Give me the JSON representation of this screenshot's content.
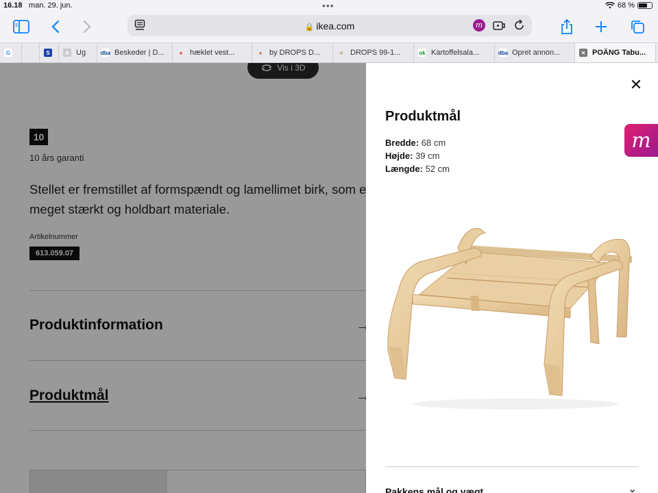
{
  "status": {
    "time": "16.18",
    "date": "man. 29. jun.",
    "battery": "68 %",
    "battery_level": 0.68
  },
  "browser": {
    "host": "ikea.com"
  },
  "tabs": [
    {
      "label": "",
      "fav": "G",
      "fav_color": "#4285f4",
      "fav_bg": "#fff"
    },
    {
      "label": "",
      "fav": "",
      "fav_color": "#fff",
      "fav_bg": "transparent"
    },
    {
      "label": "",
      "fav": "S",
      "fav_color": "#fff",
      "fav_bg": "#1a3fa8"
    },
    {
      "label": "Ug",
      "fav": "A",
      "fav_color": "#fff",
      "fav_bg": "#c9c9cf"
    },
    {
      "label": "Beskeder | D...",
      "fav": "dba",
      "fav_color": "#0a3f8f",
      "fav_bg": "#fff"
    },
    {
      "label": "hæklet vest...",
      "fav": "●",
      "fav_color": "#ea4335",
      "fav_bg": "transparent"
    },
    {
      "label": "by DROPS D...",
      "fav": "●",
      "fav_color": "#c0763a",
      "fav_bg": "transparent"
    },
    {
      "label": "DROPS 99-1...",
      "fav": "≡",
      "fav_color": "#a6781b",
      "fav_bg": "transparent"
    },
    {
      "label": "Kartoffelsala...",
      "fav": "ok",
      "fav_color": "#1a8f2a",
      "fav_bg": "#fff"
    },
    {
      "label": "Opret annon...",
      "fav": "dba",
      "fav_color": "#0a3f8f",
      "fav_bg": "#fff"
    },
    {
      "label": "POÄNG Tabu...",
      "fav": "✕",
      "fav_color": "#fff",
      "fav_bg": "#777",
      "active": true
    }
  ],
  "page": {
    "vis3d": "Vis i 3D",
    "warranty_badge": "10",
    "warranty_text": "10 års garanti",
    "description": "Stellet er fremstillet af formspændt og lamellimet birk, som er et meget stærkt og holdbart materiale.",
    "article_label": "Artikelnummer",
    "article_number": "613.059.07",
    "section1": "Produktinformation",
    "section2": "Produktmål"
  },
  "modal": {
    "title": "Produktmål",
    "dimensions": [
      {
        "label": "Bredde:",
        "value": "68 cm"
      },
      {
        "label": "Højde:",
        "value": "39 cm"
      },
      {
        "label": "Længde:",
        "value": "52 cm"
      }
    ],
    "package_section": "Pakkens mål og vægt"
  },
  "colors": {
    "accent": "#0a84ff",
    "overlay": "rgba(0,0,0,0.4)",
    "badge_gradient_start": "#e02070",
    "badge_gradient_end": "#9b1a8f"
  }
}
